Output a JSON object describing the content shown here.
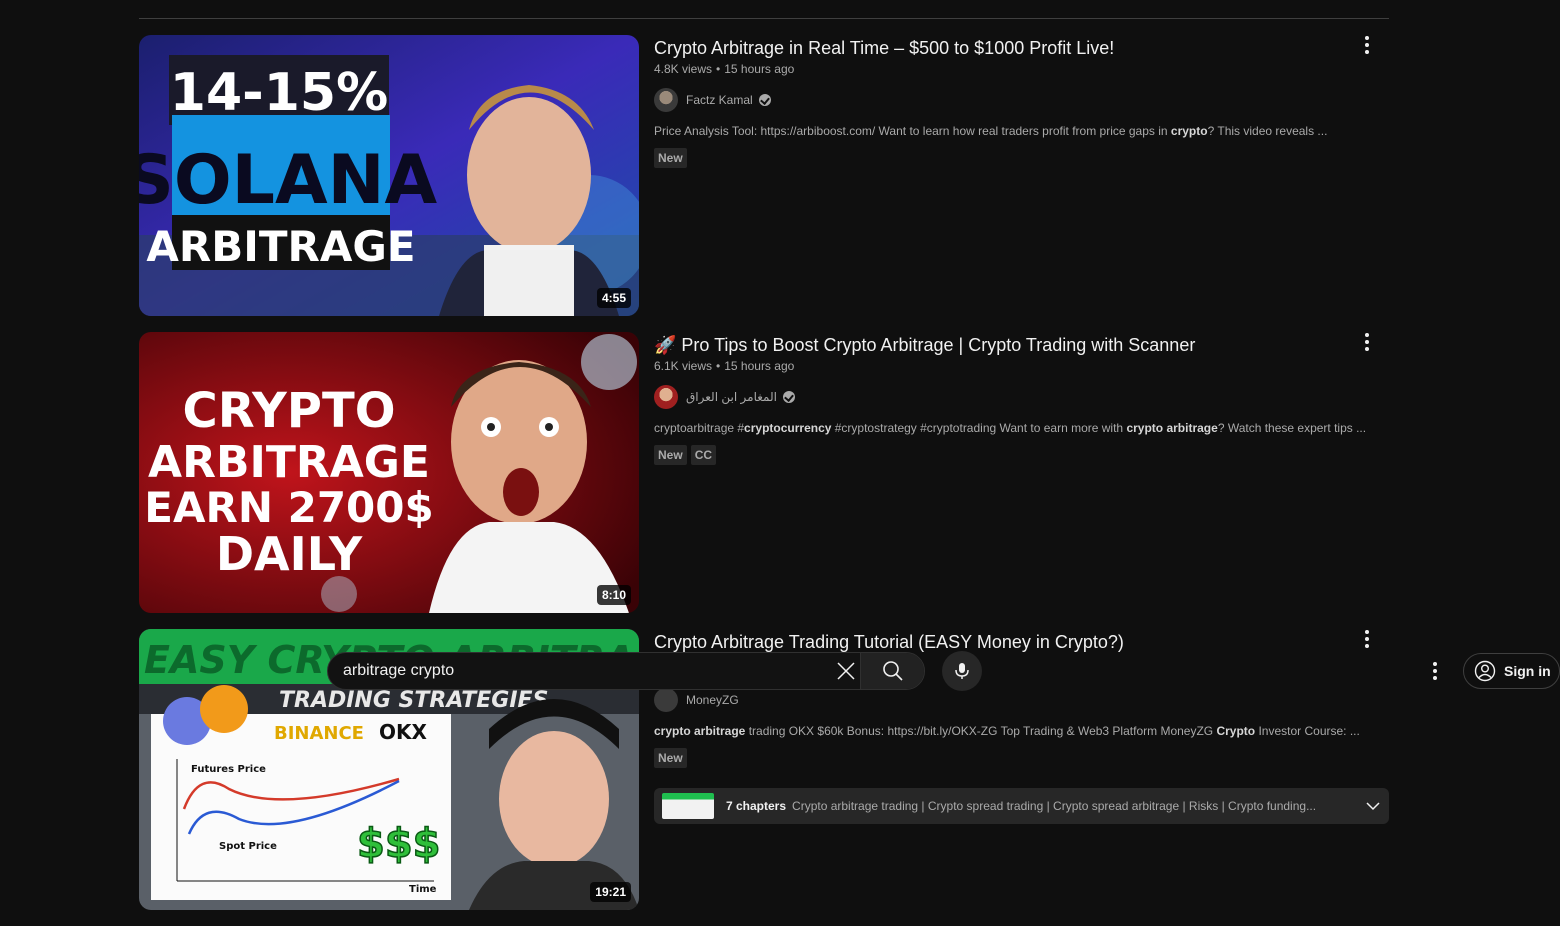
{
  "search": {
    "query": "arbitrage crypto",
    "clear_icon": "close-icon",
    "search_icon": "search-icon",
    "mic_icon": "microphone-icon"
  },
  "header": {
    "sign_in_label": "Sign in"
  },
  "videos": [
    {
      "title": "Crypto Arbitrage in Real Time – $500 to $1000 Profit Live!",
      "views": "4.8K views",
      "age": "15 hours ago",
      "channel": "Factz Kamal",
      "verified": true,
      "description": "Price Analysis Tool: https://arbiboost.com/ Want to learn how real traders profit from price gaps in crypto? This video reveals ...",
      "desc_before": "Price Analysis Tool: https://arbiboost.com/ Want to learn how real traders profit from price gaps in ",
      "desc_bold": "crypto",
      "desc_after": "? This video reveals ...",
      "badges": [
        "New"
      ],
      "duration": "4:55",
      "thumbnail_text": [
        "14-15%",
        "SOLANA",
        "ARBITRAGE"
      ]
    },
    {
      "title": "🚀 Pro Tips to Boost Crypto Arbitrage | Crypto Trading with Scanner",
      "views": "6.1K views",
      "age": "15 hours ago",
      "channel": "المغامر ابن العراق",
      "verified": true,
      "desc_1": "cryptoarbitrage #",
      "desc_2": "cryptocurrency",
      "desc_3": " #cryptostrategy #cryptotrading Want to earn more with ",
      "desc_4": "crypto arbitrage",
      "desc_5": "? Watch these expert tips ...",
      "badges": [
        "New",
        "CC"
      ],
      "duration": "8:10",
      "thumbnail_text": [
        "CRYPTO",
        "ARBITRAGE",
        "EARN 2700$",
        "DAILY"
      ]
    },
    {
      "title": "Crypto Arbitrage Trading Tutorial (EASY Money in Crypto?)",
      "channel": "MoneyZG",
      "desc_1": "crypto arbitrage",
      "desc_2": " trading OKX $60k Bonus: https://bit.ly/OKX-ZG Top Trading & Web3 Platform MoneyZG ",
      "desc_3": "Crypto",
      "desc_4": " Investor Course: ...",
      "badges": [
        "New"
      ],
      "duration": "19:21",
      "chapters_count": "7 chapters",
      "chapters_list": "Crypto arbitrage trading | Crypto spread trading | Crypto spread arbitrage | Risks | Crypto funding...",
      "thumbnail_text": [
        "EASY CRYPTO ARBITRAGE",
        "TRADING STRATEGIES",
        "BINANCE",
        "OKX",
        "Futures Price",
        "Spot Price",
        "Time",
        "$$$"
      ]
    }
  ]
}
